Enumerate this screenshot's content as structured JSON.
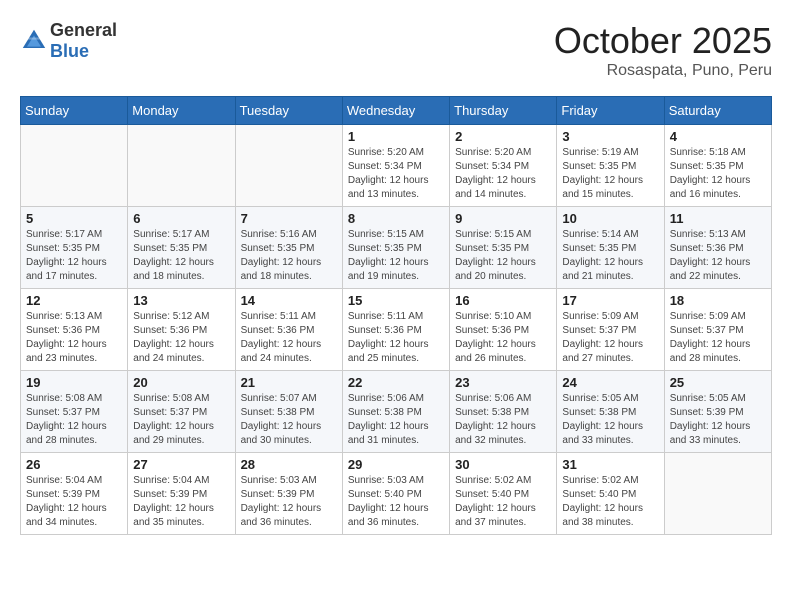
{
  "header": {
    "logo_general": "General",
    "logo_blue": "Blue",
    "month": "October 2025",
    "location": "Rosaspata, Puno, Peru"
  },
  "days_of_week": [
    "Sunday",
    "Monday",
    "Tuesday",
    "Wednesday",
    "Thursday",
    "Friday",
    "Saturday"
  ],
  "weeks": [
    [
      {
        "day": "",
        "info": ""
      },
      {
        "day": "",
        "info": ""
      },
      {
        "day": "",
        "info": ""
      },
      {
        "day": "1",
        "info": "Sunrise: 5:20 AM\nSunset: 5:34 PM\nDaylight: 12 hours\nand 13 minutes."
      },
      {
        "day": "2",
        "info": "Sunrise: 5:20 AM\nSunset: 5:34 PM\nDaylight: 12 hours\nand 14 minutes."
      },
      {
        "day": "3",
        "info": "Sunrise: 5:19 AM\nSunset: 5:35 PM\nDaylight: 12 hours\nand 15 minutes."
      },
      {
        "day": "4",
        "info": "Sunrise: 5:18 AM\nSunset: 5:35 PM\nDaylight: 12 hours\nand 16 minutes."
      }
    ],
    [
      {
        "day": "5",
        "info": "Sunrise: 5:17 AM\nSunset: 5:35 PM\nDaylight: 12 hours\nand 17 minutes."
      },
      {
        "day": "6",
        "info": "Sunrise: 5:17 AM\nSunset: 5:35 PM\nDaylight: 12 hours\nand 18 minutes."
      },
      {
        "day": "7",
        "info": "Sunrise: 5:16 AM\nSunset: 5:35 PM\nDaylight: 12 hours\nand 18 minutes."
      },
      {
        "day": "8",
        "info": "Sunrise: 5:15 AM\nSunset: 5:35 PM\nDaylight: 12 hours\nand 19 minutes."
      },
      {
        "day": "9",
        "info": "Sunrise: 5:15 AM\nSunset: 5:35 PM\nDaylight: 12 hours\nand 20 minutes."
      },
      {
        "day": "10",
        "info": "Sunrise: 5:14 AM\nSunset: 5:35 PM\nDaylight: 12 hours\nand 21 minutes."
      },
      {
        "day": "11",
        "info": "Sunrise: 5:13 AM\nSunset: 5:36 PM\nDaylight: 12 hours\nand 22 minutes."
      }
    ],
    [
      {
        "day": "12",
        "info": "Sunrise: 5:13 AM\nSunset: 5:36 PM\nDaylight: 12 hours\nand 23 minutes."
      },
      {
        "day": "13",
        "info": "Sunrise: 5:12 AM\nSunset: 5:36 PM\nDaylight: 12 hours\nand 24 minutes."
      },
      {
        "day": "14",
        "info": "Sunrise: 5:11 AM\nSunset: 5:36 PM\nDaylight: 12 hours\nand 24 minutes."
      },
      {
        "day": "15",
        "info": "Sunrise: 5:11 AM\nSunset: 5:36 PM\nDaylight: 12 hours\nand 25 minutes."
      },
      {
        "day": "16",
        "info": "Sunrise: 5:10 AM\nSunset: 5:36 PM\nDaylight: 12 hours\nand 26 minutes."
      },
      {
        "day": "17",
        "info": "Sunrise: 5:09 AM\nSunset: 5:37 PM\nDaylight: 12 hours\nand 27 minutes."
      },
      {
        "day": "18",
        "info": "Sunrise: 5:09 AM\nSunset: 5:37 PM\nDaylight: 12 hours\nand 28 minutes."
      }
    ],
    [
      {
        "day": "19",
        "info": "Sunrise: 5:08 AM\nSunset: 5:37 PM\nDaylight: 12 hours\nand 28 minutes."
      },
      {
        "day": "20",
        "info": "Sunrise: 5:08 AM\nSunset: 5:37 PM\nDaylight: 12 hours\nand 29 minutes."
      },
      {
        "day": "21",
        "info": "Sunrise: 5:07 AM\nSunset: 5:38 PM\nDaylight: 12 hours\nand 30 minutes."
      },
      {
        "day": "22",
        "info": "Sunrise: 5:06 AM\nSunset: 5:38 PM\nDaylight: 12 hours\nand 31 minutes."
      },
      {
        "day": "23",
        "info": "Sunrise: 5:06 AM\nSunset: 5:38 PM\nDaylight: 12 hours\nand 32 minutes."
      },
      {
        "day": "24",
        "info": "Sunrise: 5:05 AM\nSunset: 5:38 PM\nDaylight: 12 hours\nand 33 minutes."
      },
      {
        "day": "25",
        "info": "Sunrise: 5:05 AM\nSunset: 5:39 PM\nDaylight: 12 hours\nand 33 minutes."
      }
    ],
    [
      {
        "day": "26",
        "info": "Sunrise: 5:04 AM\nSunset: 5:39 PM\nDaylight: 12 hours\nand 34 minutes."
      },
      {
        "day": "27",
        "info": "Sunrise: 5:04 AM\nSunset: 5:39 PM\nDaylight: 12 hours\nand 35 minutes."
      },
      {
        "day": "28",
        "info": "Sunrise: 5:03 AM\nSunset: 5:39 PM\nDaylight: 12 hours\nand 36 minutes."
      },
      {
        "day": "29",
        "info": "Sunrise: 5:03 AM\nSunset: 5:40 PM\nDaylight: 12 hours\nand 36 minutes."
      },
      {
        "day": "30",
        "info": "Sunrise: 5:02 AM\nSunset: 5:40 PM\nDaylight: 12 hours\nand 37 minutes."
      },
      {
        "day": "31",
        "info": "Sunrise: 5:02 AM\nSunset: 5:40 PM\nDaylight: 12 hours\nand 38 minutes."
      },
      {
        "day": "",
        "info": ""
      }
    ]
  ]
}
